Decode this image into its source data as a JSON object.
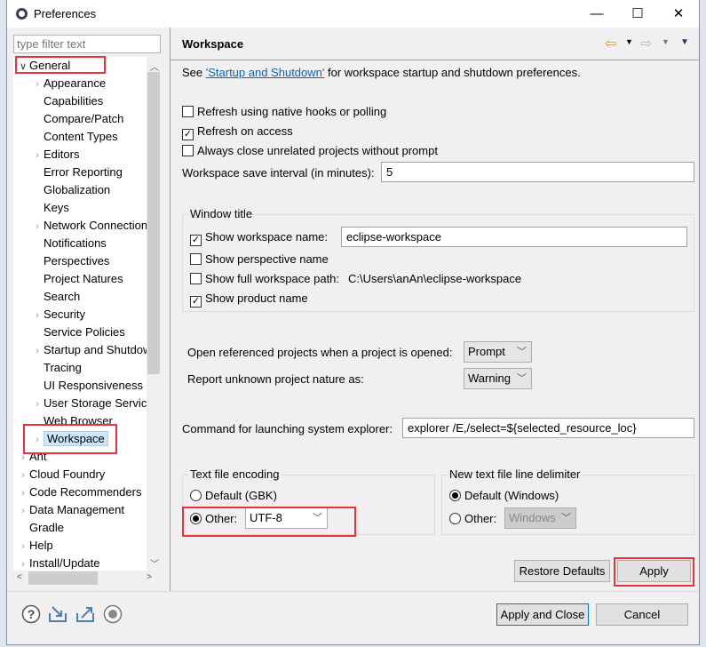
{
  "window": {
    "title": "Preferences",
    "minimize": "—",
    "maximize": "☐",
    "close": "✕"
  },
  "filter": {
    "placeholder": "type filter text"
  },
  "tree": [
    {
      "label": "General",
      "level": 0,
      "twisty": "expanded"
    },
    {
      "label": "Appearance",
      "level": 1,
      "twisty": "collapsed"
    },
    {
      "label": "Capabilities",
      "level": 1,
      "twisty": "none"
    },
    {
      "label": "Compare/Patch",
      "level": 1,
      "twisty": "none"
    },
    {
      "label": "Content Types",
      "level": 1,
      "twisty": "none"
    },
    {
      "label": "Editors",
      "level": 1,
      "twisty": "collapsed"
    },
    {
      "label": "Error Reporting",
      "level": 1,
      "twisty": "none"
    },
    {
      "label": "Globalization",
      "level": 1,
      "twisty": "none"
    },
    {
      "label": "Keys",
      "level": 1,
      "twisty": "none"
    },
    {
      "label": "Network Connections",
      "level": 1,
      "twisty": "collapsed"
    },
    {
      "label": "Notifications",
      "level": 1,
      "twisty": "none"
    },
    {
      "label": "Perspectives",
      "level": 1,
      "twisty": "none"
    },
    {
      "label": "Project Natures",
      "level": 1,
      "twisty": "none"
    },
    {
      "label": "Search",
      "level": 1,
      "twisty": "none"
    },
    {
      "label": "Security",
      "level": 1,
      "twisty": "collapsed"
    },
    {
      "label": "Service Policies",
      "level": 1,
      "twisty": "none"
    },
    {
      "label": "Startup and Shutdown",
      "level": 1,
      "twisty": "collapsed"
    },
    {
      "label": "Tracing",
      "level": 1,
      "twisty": "none"
    },
    {
      "label": "UI Responsiveness",
      "level": 1,
      "twisty": "none"
    },
    {
      "label": "User Storage Service",
      "level": 1,
      "twisty": "collapsed"
    },
    {
      "label": "Web Browser",
      "level": 1,
      "twisty": "none"
    },
    {
      "label": "Workspace",
      "level": 1,
      "twisty": "collapsed",
      "selected": true
    },
    {
      "label": "Ant",
      "level": 0,
      "twisty": "collapsed"
    },
    {
      "label": "Cloud Foundry",
      "level": 0,
      "twisty": "collapsed"
    },
    {
      "label": "Code Recommenders",
      "level": 0,
      "twisty": "collapsed"
    },
    {
      "label": "Data Management",
      "level": 0,
      "twisty": "collapsed"
    },
    {
      "label": "Gradle",
      "level": 0,
      "twisty": "none"
    },
    {
      "label": "Help",
      "level": 0,
      "twisty": "collapsed"
    },
    {
      "label": "Install/Update",
      "level": 0,
      "twisty": "collapsed"
    }
  ],
  "page": {
    "title": "Workspace",
    "intro_pre": "See ",
    "intro_link": "'Startup and Shutdown'",
    "intro_post": " for workspace startup and shutdown preferences.",
    "checks": [
      {
        "label": "Refresh using native hooks or polling",
        "checked": false
      },
      {
        "label": "Refresh on access",
        "checked": true
      },
      {
        "label": "Always close unrelated projects without prompt",
        "checked": false
      }
    ],
    "save_interval_label": "Workspace save interval (in minutes):",
    "save_interval_value": "5",
    "window_title": {
      "group": "Window title",
      "show_name": {
        "label": "Show workspace name:",
        "checked": true,
        "value": "eclipse-workspace"
      },
      "show_perspective": {
        "label": "Show perspective name",
        "checked": false
      },
      "show_path": {
        "label": "Show full workspace path:",
        "checked": false,
        "value": "C:\\Users\\anAn\\eclipse-workspace"
      },
      "show_product": {
        "label": "Show product name",
        "checked": true
      }
    },
    "open_ref_label": "Open referenced projects when a project is opened:",
    "open_ref_value": "Prompt",
    "report_label": "Report unknown project nature as:",
    "report_value": "Warning",
    "explorer_label": "Command for launching system explorer:",
    "explorer_value": "explorer /E,/select=${selected_resource_loc}",
    "encoding": {
      "group": "Text file encoding",
      "default_label": "Default (GBK)",
      "other_label": "Other:",
      "other_value": "UTF-8",
      "selected": "other"
    },
    "delimiter": {
      "group": "New text file line delimiter",
      "default_label": "Default (Windows)",
      "other_label": "Other:",
      "other_value": "Windows",
      "selected": "default"
    },
    "restore_defaults": "Restore Defaults",
    "apply": "Apply"
  },
  "footer": {
    "apply_close": "Apply and Close",
    "cancel": "Cancel"
  },
  "colors": {
    "highlight": "#e8333b",
    "selection": "#cce8ff",
    "link": "#0066cc"
  }
}
